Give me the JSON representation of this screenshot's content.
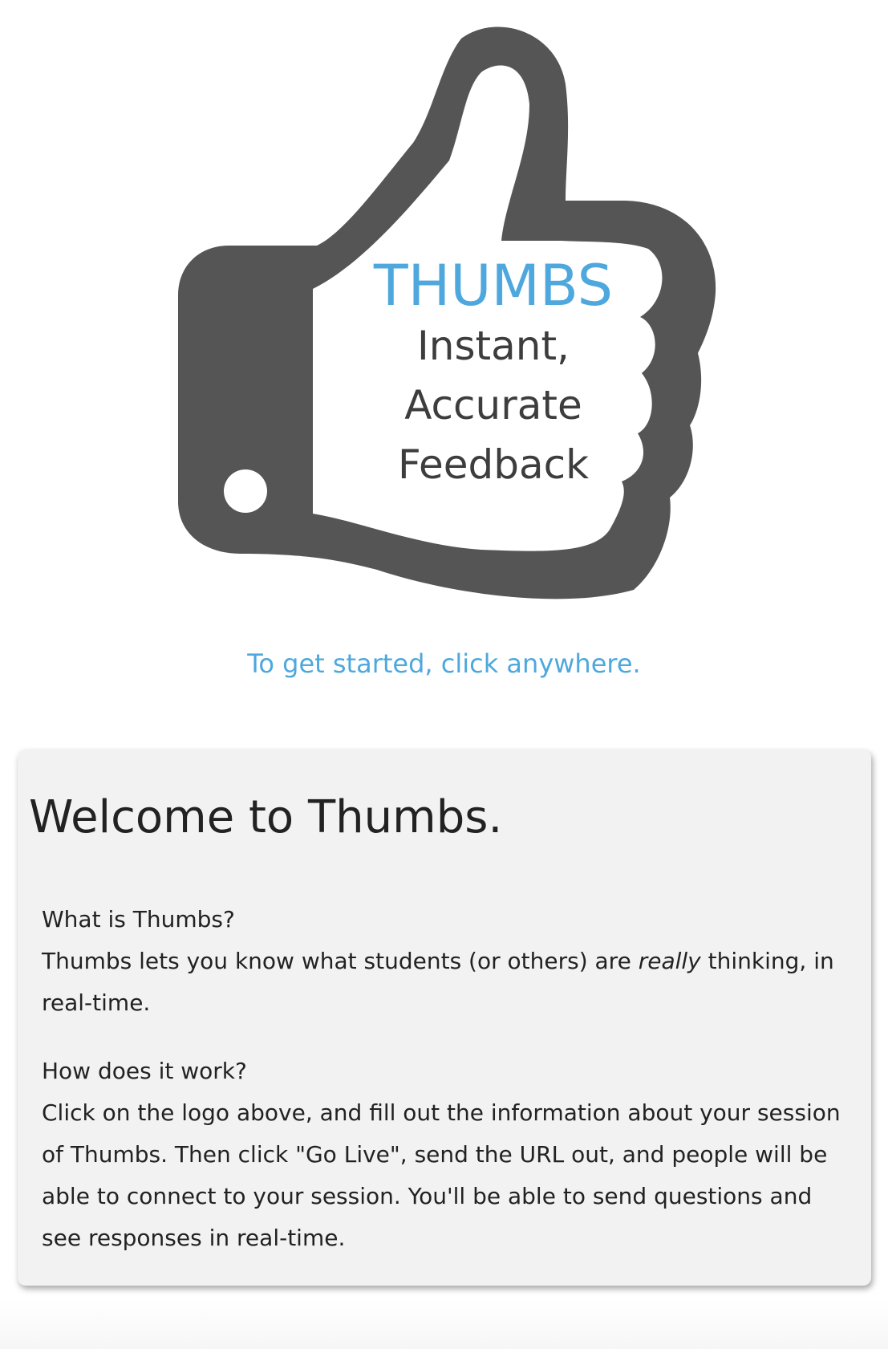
{
  "logo": {
    "icon": "thumbs-up-icon",
    "brand": "THUMBS",
    "tagline": [
      "Instant,",
      "Accurate",
      "Feedback"
    ],
    "brand_color": "#4ea8dd",
    "icon_color": "#555555"
  },
  "cta": {
    "text": "To get started, click anywhere.",
    "color": "#4ea8dd"
  },
  "welcome": {
    "title": "Welcome to Thumbs.",
    "sections": [
      {
        "question": "What is Thumbs?",
        "answer_before": "Thumbs lets you know what students (or others) are ",
        "answer_emphasis": "really",
        "answer_after": " thinking, in real-time."
      },
      {
        "question": "How does it work?",
        "answer": "Click on the logo above, and fill out the information about your session of Thumbs. Then click \"Go Live\", send the URL out, and people will be able to connect to your session. You'll be able to send questions and see responses in real-time."
      }
    ]
  }
}
